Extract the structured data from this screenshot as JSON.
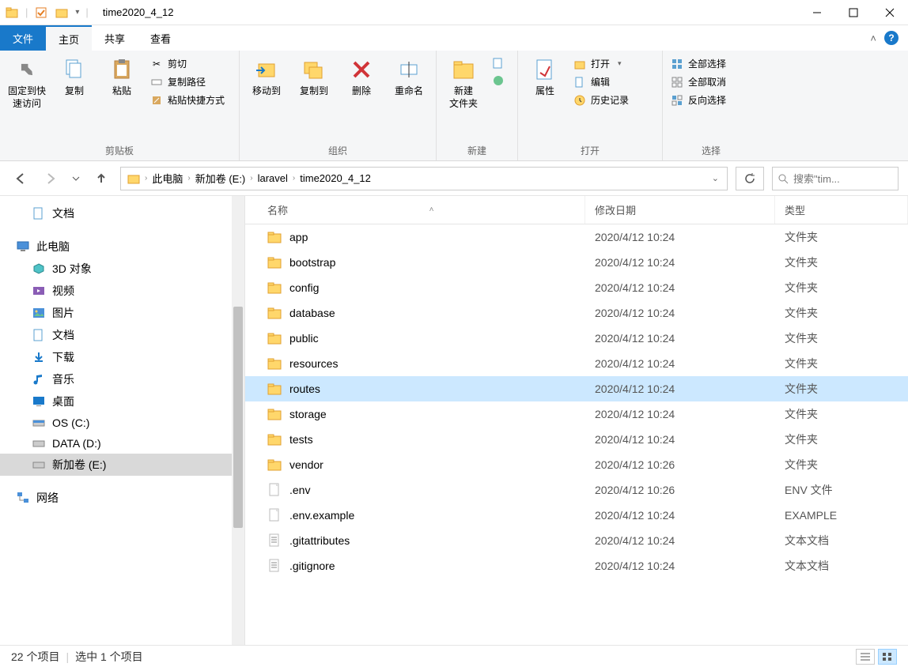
{
  "window": {
    "title": "time2020_4_12"
  },
  "ribbon_tabs": {
    "file": "文件",
    "home": "主页",
    "share": "共享",
    "view": "查看"
  },
  "ribbon": {
    "clipboard": {
      "label": "剪贴板",
      "pin": "固定到快\n速访问",
      "copy": "复制",
      "paste": "粘贴",
      "cut": "剪切",
      "copy_path": "复制路径",
      "paste_shortcut": "粘贴快捷方式"
    },
    "organize": {
      "label": "组织",
      "move_to": "移动到",
      "copy_to": "复制到",
      "delete": "删除",
      "rename": "重命名"
    },
    "new": {
      "label": "新建",
      "new_folder": "新建\n文件夹"
    },
    "open": {
      "label": "打开",
      "properties": "属性",
      "open": "打开",
      "edit": "编辑",
      "history": "历史记录"
    },
    "select": {
      "label": "选择",
      "select_all": "全部选择",
      "select_none": "全部取消",
      "invert": "反向选择"
    }
  },
  "breadcrumb": {
    "items": [
      "此电脑",
      "新加卷 (E:)",
      "laravel",
      "time2020_4_12"
    ]
  },
  "search": {
    "placeholder": "搜索\"tim..."
  },
  "tree": {
    "documents": "文档",
    "this_pc": "此电脑",
    "objects_3d": "3D 对象",
    "videos": "视频",
    "pictures": "图片",
    "docs": "文档",
    "downloads": "下载",
    "music": "音乐",
    "desktop": "桌面",
    "drive_c": "OS (C:)",
    "drive_d": "DATA (D:)",
    "drive_e": "新加卷 (E:)",
    "network": "网络"
  },
  "columns": {
    "name": "名称",
    "date": "修改日期",
    "type": "类型"
  },
  "files": [
    {
      "name": "app",
      "date": "2020/4/12 10:24",
      "type": "文件夹",
      "icon": "folder",
      "selected": false
    },
    {
      "name": "bootstrap",
      "date": "2020/4/12 10:24",
      "type": "文件夹",
      "icon": "folder",
      "selected": false
    },
    {
      "name": "config",
      "date": "2020/4/12 10:24",
      "type": "文件夹",
      "icon": "folder",
      "selected": false
    },
    {
      "name": "database",
      "date": "2020/4/12 10:24",
      "type": "文件夹",
      "icon": "folder",
      "selected": false
    },
    {
      "name": "public",
      "date": "2020/4/12 10:24",
      "type": "文件夹",
      "icon": "folder",
      "selected": false
    },
    {
      "name": "resources",
      "date": "2020/4/12 10:24",
      "type": "文件夹",
      "icon": "folder",
      "selected": false
    },
    {
      "name": "routes",
      "date": "2020/4/12 10:24",
      "type": "文件夹",
      "icon": "folder",
      "selected": true
    },
    {
      "name": "storage",
      "date": "2020/4/12 10:24",
      "type": "文件夹",
      "icon": "folder",
      "selected": false
    },
    {
      "name": "tests",
      "date": "2020/4/12 10:24",
      "type": "文件夹",
      "icon": "folder",
      "selected": false
    },
    {
      "name": "vendor",
      "date": "2020/4/12 10:26",
      "type": "文件夹",
      "icon": "folder",
      "selected": false
    },
    {
      "name": ".env",
      "date": "2020/4/12 10:26",
      "type": "ENV 文件",
      "icon": "file",
      "selected": false
    },
    {
      "name": ".env.example",
      "date": "2020/4/12 10:24",
      "type": "EXAMPLE",
      "icon": "file",
      "selected": false
    },
    {
      "name": ".gitattributes",
      "date": "2020/4/12 10:24",
      "type": "文本文档",
      "icon": "text",
      "selected": false
    },
    {
      "name": ".gitignore",
      "date": "2020/4/12 10:24",
      "type": "文本文档",
      "icon": "text",
      "selected": false
    }
  ],
  "status": {
    "count": "22 个项目",
    "selected": "选中 1 个项目"
  }
}
